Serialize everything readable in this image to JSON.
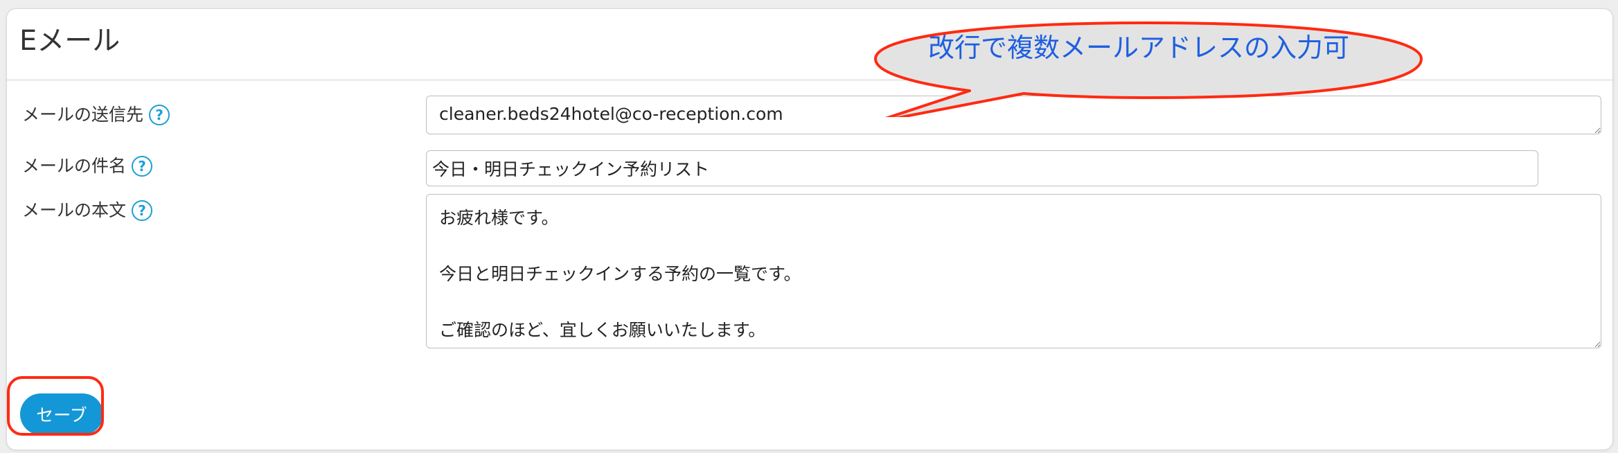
{
  "panel": {
    "title": "Eメール"
  },
  "form": {
    "to": {
      "label": "メールの送信先",
      "value": "cleaner.beds24hotel@co-reception.com"
    },
    "subject": {
      "label": "メールの件名",
      "value": "今日・明日チェックイン予約リスト"
    },
    "body": {
      "label": "メールの本文",
      "value": "お疲れ様です。\n\n今日と明日チェックインする予約の一覧です。\n\nご確認のほど、宜しくお願いいたします。"
    },
    "help_glyph": "?"
  },
  "actions": {
    "save_label": "セーブ"
  },
  "annotation": {
    "callout_text": "改行で複数メールアドレスの入力可"
  },
  "colors": {
    "accent": "#1497d6",
    "annotation_red": "#ff2a12",
    "annotation_text": "#1f5fe0",
    "callout_fill": "#e3e3e3"
  }
}
